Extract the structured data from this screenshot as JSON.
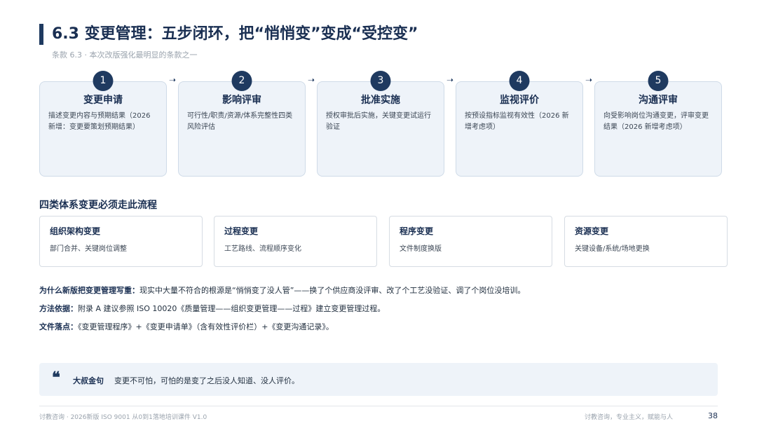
{
  "slide": {
    "title": "6.3 变更管理：五步闭环，把“悄悄变”变成“受控变”",
    "subtitle": "条款 6.3 · 本次改版强化最明显的条款之一"
  },
  "steps": [
    {
      "num": "1",
      "title": "变更申请",
      "desc": "描述变更内容与预期结果（2026 新增：变更要策划预期结果）"
    },
    {
      "num": "2",
      "title": "影响评审",
      "desc": "可行性/职责/资源/体系完整性四类风险评估"
    },
    {
      "num": "3",
      "title": "批准实施",
      "desc": "授权审批后实施，关键变更试运行验证"
    },
    {
      "num": "4",
      "title": "监视评价",
      "desc": "按预设指标监视有效性（2026 新增考虑项）"
    },
    {
      "num": "5",
      "title": "沟通评审",
      "desc": "向受影响岗位沟通变更，评审变更结果（2026 新增考虑项）"
    }
  ],
  "types_section": {
    "heading": "四类体系变更必须走此流程",
    "items": [
      {
        "title": "组织架构变更",
        "desc": "部门合并、关键岗位调整"
      },
      {
        "title": "过程变更",
        "desc": "工艺路线、流程顺序变化"
      },
      {
        "title": "程序变更",
        "desc": "文件制度换版"
      },
      {
        "title": "资源变更",
        "desc": "关键设备/系统/场地更换"
      }
    ]
  },
  "notes": [
    {
      "label": "为什么新版把变更管理写重：",
      "text": "现实中大量不符合的根源是“悄悄变了没人管”——换了个供应商没评审、改了个工艺没验证、调了个岗位没培训。"
    },
    {
      "label": "方法依据：",
      "text": "附录 A 建议参照 ISO 10020《质量管理——组织变更管理——过程》建立变更管理过程。"
    },
    {
      "label": "文件落点：",
      "text": "《变更管理程序》+《变更申请单》（含有效性评价栏）+《变更沟通记录》。"
    }
  ],
  "quote": {
    "icon": "quote-icon",
    "label": "大叔金句",
    "text": "变更不可怕，可怕的是变了之后没人知道、没人评价。"
  },
  "footer": {
    "left": "讨教咨询 · 2026新版 ISO 9001 从0到1落地培训课件 V1.0",
    "right": "讨教咨询，专业主义，赋能与人",
    "page": "38"
  },
  "colors": {
    "accent": "#1f3a60",
    "card_bg": "#eef3f9",
    "card_border": "#cfdbe8"
  }
}
